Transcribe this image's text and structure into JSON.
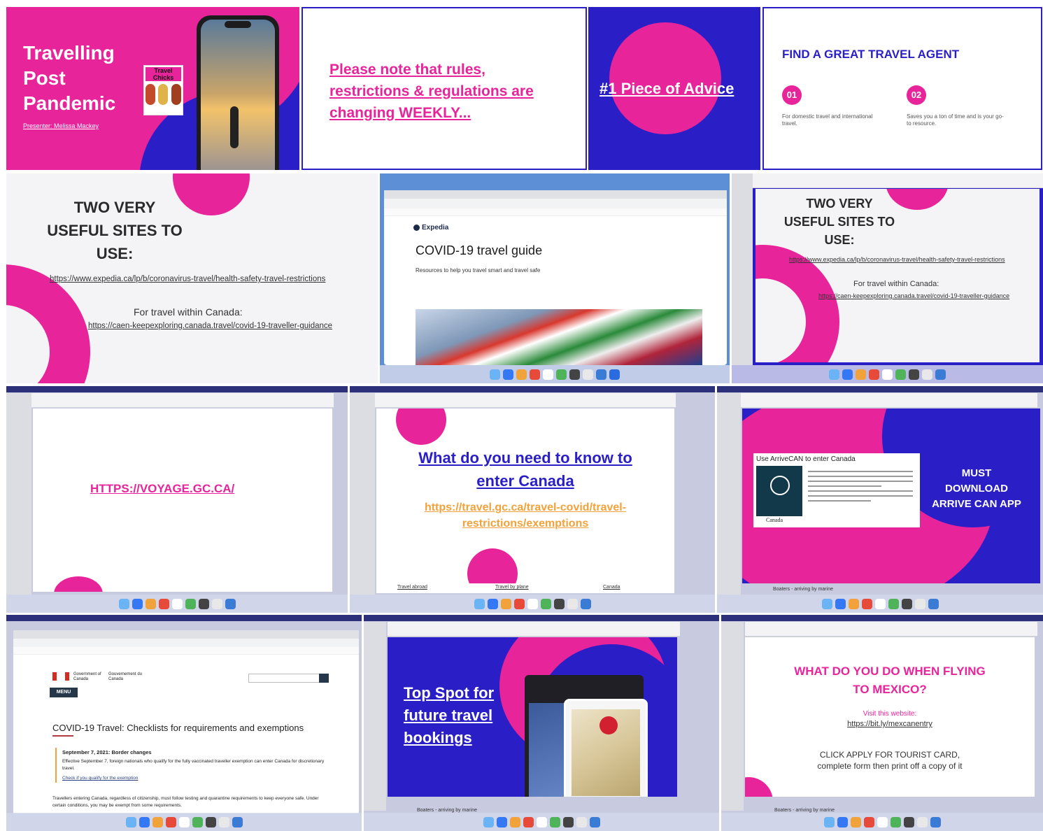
{
  "colors": {
    "pink": "#e8249a",
    "navy": "#2a1fc7",
    "orange": "#f2a23a",
    "dark": "#333333"
  },
  "t1": {
    "title_lines": [
      "Travelling",
      "Post",
      "Pandemic"
    ],
    "presenter": "Presenter: Melissa Mackey",
    "badge_lines": [
      "Travel",
      "Chicks"
    ]
  },
  "t2": {
    "lines": [
      "Please note that rules,",
      "restrictions & regulations are",
      "changing WEEKLY..."
    ]
  },
  "t3": {
    "text": "#1 Piece of Advice"
  },
  "t4": {
    "title": "FIND A GREAT TRAVEL AGENT",
    "n1": "01",
    "d1": "For domestic travel and international travel.",
    "n2": "02",
    "d2": "Saves you a ton of time and is your go-to resource."
  },
  "t5": {
    "title_lines": [
      "TWO VERY",
      "USEFUL SITES TO",
      "USE:"
    ],
    "link1": "https://www.expedia.ca/lp/b/coronavirus-travel/health-safety-travel-restrictions",
    "within": "For travel within Canada:",
    "link2": "https://caen-keepexploring.canada.travel/covid-19-traveller-guidance"
  },
  "t6": {
    "brand": "Expedia",
    "heading": "COVID-19 travel guide",
    "sub": "Resources to help you travel smart and travel safe"
  },
  "t7": {
    "title_lines": [
      "TWO VERY",
      "USEFUL SITES TO",
      "USE:"
    ],
    "link1": "https://www.expedia.ca/lp/b/coronavirus-travel/health-safety-travel-restrictions",
    "within": "For travel within Canada:",
    "link2": "https://caen-keepexploring.canada.travel/covid-19-traveller-guidance"
  },
  "t8": {
    "link": "HTTPS://VOYAGE.GC.CA/"
  },
  "t9": {
    "heading_lines": [
      "What do you need to know to",
      "enter Canada"
    ],
    "link_lines": [
      "https://travel.gc.ca/travel-covid/travel-",
      "restrictions/exemptions"
    ],
    "footer": [
      "Travel abroad",
      "Travel by plane",
      "Canada"
    ]
  },
  "t10": {
    "card_title": "Use ArriveCAN to enter Canada",
    "app_name": "Canada",
    "side_lines": [
      "MUST",
      "DOWNLOAD",
      "ARRIVE CAN APP"
    ],
    "footer": "Boaters - arriving by marine"
  },
  "t11": {
    "gov1": "Government of Canada",
    "gov2": "Gouvernement du Canada",
    "menu": "MENU",
    "heading": "COVID-19 Travel: Checklists for requirements and exemptions",
    "date": "September 7, 2021: Border changes",
    "effective": "Effective September 7, foreign nationals who qualify for the fully vaccinated traveller exemption can enter Canada for discretionary travel.",
    "check_link": "Check if you qualify for the exemption",
    "body": "Travellers entering Canada, regardless of citizenship, must follow testing and quarantine requirements to keep everyone safe. Under certain conditions, you may be exempt from some requirements."
  },
  "t12": {
    "lines": [
      "Top Spot for",
      "future travel",
      "bookings"
    ],
    "footer": "Boaters - arriving by marine"
  },
  "t13": {
    "title_lines": [
      "WHAT DO YOU DO WHEN FLYING",
      "TO MEXICO?"
    ],
    "visit": "Visit this website:",
    "link": "https://bit.ly/mexcanentry",
    "body_lines": [
      "CLICK APPLY FOR TOURIST CARD,",
      "complete form then print off a copy of it"
    ],
    "footer": "Boaters - arriving by marine"
  }
}
